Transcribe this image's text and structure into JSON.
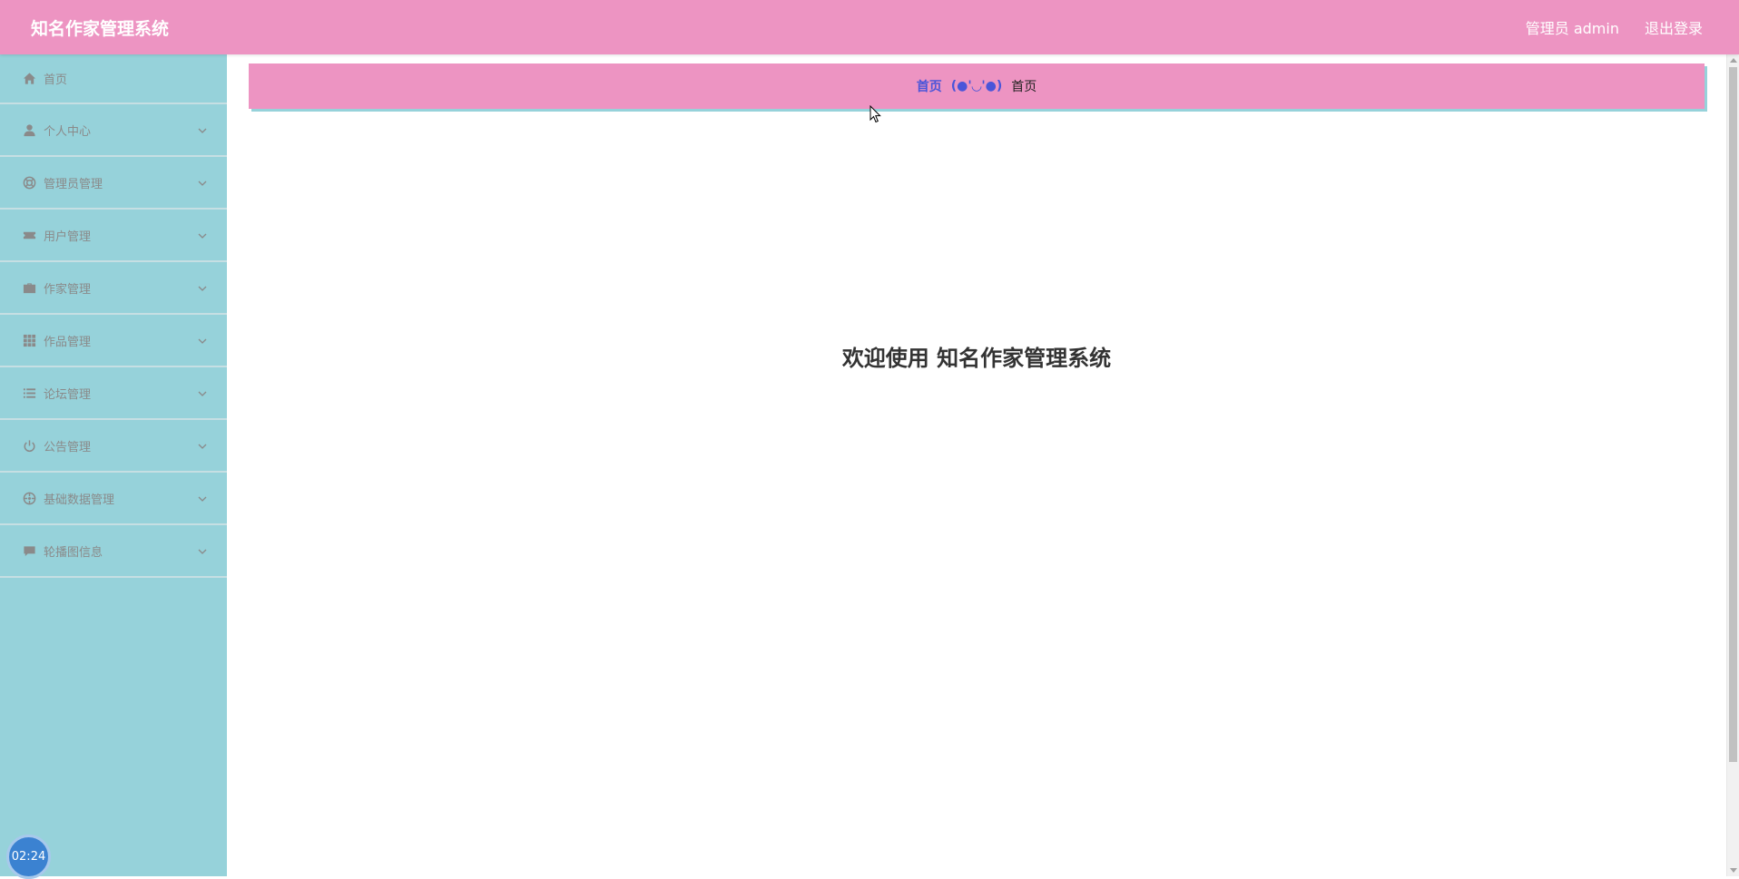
{
  "header": {
    "title": "知名作家管理系统",
    "user_label": "管理员 admin",
    "logout_label": "退出登录"
  },
  "sidebar": {
    "items": [
      {
        "label": "首页",
        "icon": "home-icon",
        "expandable": false
      },
      {
        "label": "个人中心",
        "icon": "user-icon",
        "expandable": true
      },
      {
        "label": "管理员管理",
        "icon": "lifebuoy-icon",
        "expandable": true
      },
      {
        "label": "用户管理",
        "icon": "ticket-icon",
        "expandable": true
      },
      {
        "label": "作家管理",
        "icon": "briefcase-icon",
        "expandable": true
      },
      {
        "label": "作品管理",
        "icon": "grid-icon",
        "expandable": true
      },
      {
        "label": "论坛管理",
        "icon": "list-icon",
        "expandable": true
      },
      {
        "label": "公告管理",
        "icon": "power-icon",
        "expandable": true
      },
      {
        "label": "基础数据管理",
        "icon": "aperture-icon",
        "expandable": true
      },
      {
        "label": "轮播图信息",
        "icon": "comment-icon",
        "expandable": true
      }
    ]
  },
  "breadcrumb": {
    "home": "首页",
    "separator": "(●'◡'●)",
    "current": "首页"
  },
  "main": {
    "welcome": "欢迎使用 知名作家管理系统"
  },
  "clock": {
    "time": "02:24"
  },
  "colors": {
    "header_bg": "#ed94c2",
    "sidebar_bg": "#96d2da",
    "breadcrumb_link": "#4a55d9"
  }
}
